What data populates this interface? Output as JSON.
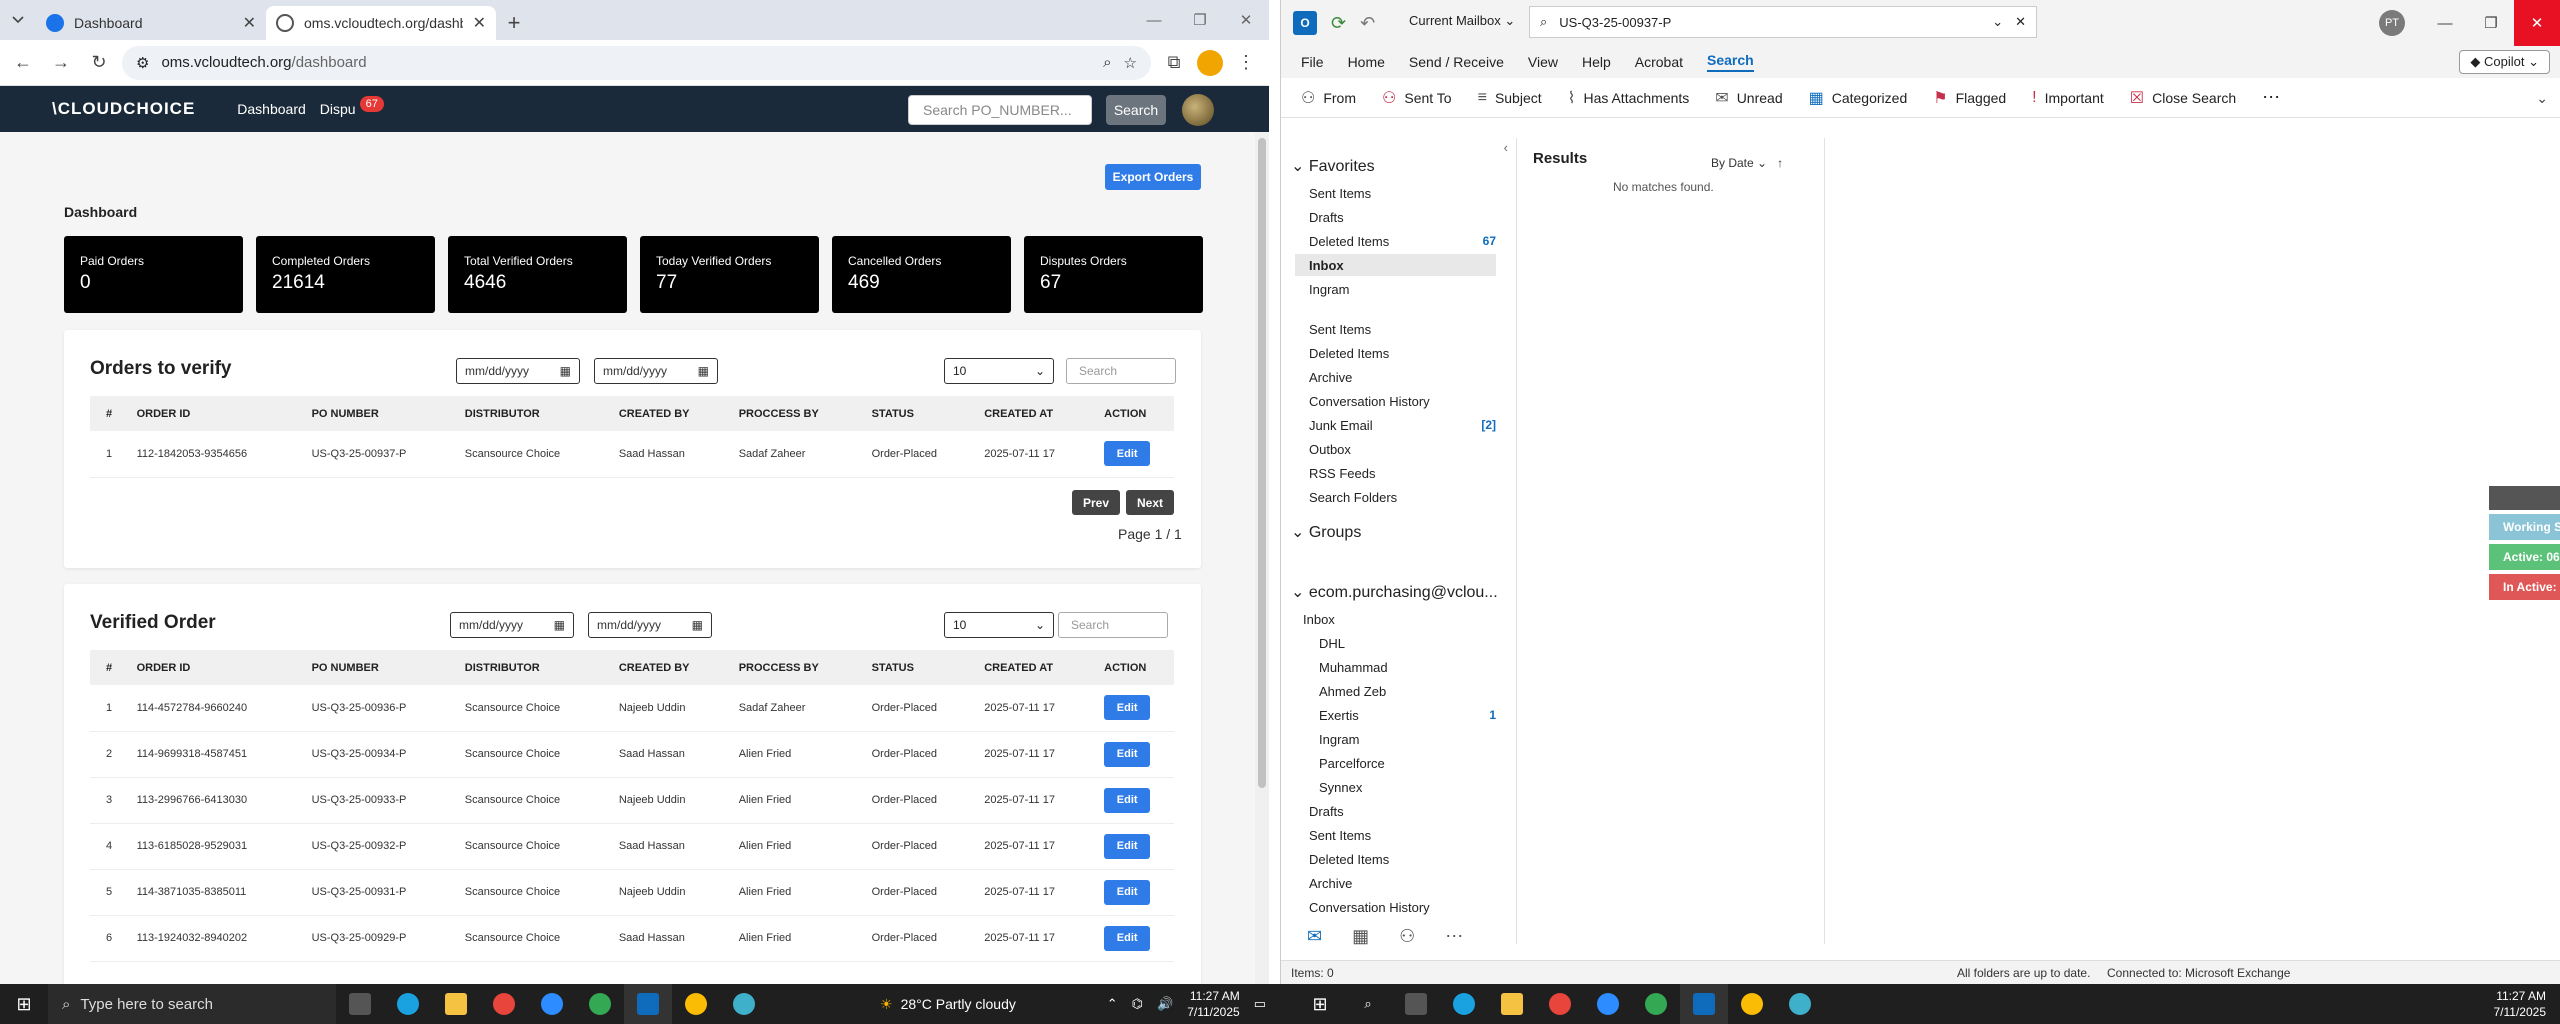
{
  "browser": {
    "tabs": [
      {
        "title": "Dashboard",
        "active": false
      },
      {
        "title": "oms.vcloudtech.org/dashboard",
        "active": true
      }
    ],
    "url_host": "oms.vcloudtech.org",
    "url_path": "/dashboard"
  },
  "app": {
    "logo": "\\CLOUDCHOICE",
    "nav": {
      "dashboard": "Dashboard",
      "disputes": "Dispu",
      "disputes_badge": "67"
    },
    "search_placeholder": "Search PO_NUMBER...",
    "search_button": "Search",
    "export_button": "Export Orders",
    "dashboard_title": "Dashboard",
    "stats": [
      {
        "label": "Paid Orders",
        "value": "0"
      },
      {
        "label": "Completed Orders",
        "value": "21614"
      },
      {
        "label": "Total Verified Orders",
        "value": "4646"
      },
      {
        "label": "Today Verified Orders",
        "value": "77"
      },
      {
        "label": "Cancelled Orders",
        "value": "469"
      },
      {
        "label": "Disputes Orders",
        "value": "67"
      }
    ],
    "date_placeholder": "mm/dd/yyyy",
    "page_size": "10",
    "table_search": "Search",
    "columns": [
      "#",
      "ORDER ID",
      "PO NUMBER",
      "DISTRIBUTOR",
      "CREATED BY",
      "PROCCESS BY",
      "STATUS",
      "CREATED AT",
      "ACTION"
    ],
    "edit_label": "Edit",
    "orders_to_verify": {
      "title": "Orders to verify",
      "rows": [
        [
          "1",
          "112-1842053-9354656",
          "US-Q3-25-00937-P",
          "Scansource Choice",
          "Saad Hassan",
          "Sadaf Zaheer",
          "Order-Placed",
          "2025-07-11 17"
        ]
      ],
      "prev": "Prev",
      "next": "Next",
      "page_info": "Page 1 / 1"
    },
    "verified_order": {
      "title": "Verified Order",
      "rows": [
        [
          "1",
          "114-4572784-9660240",
          "US-Q3-25-00936-P",
          "Scansource Choice",
          "Najeeb Uddin",
          "Sadaf Zaheer",
          "Order-Placed",
          "2025-07-11 17"
        ],
        [
          "2",
          "114-9699318-4587451",
          "US-Q3-25-00934-P",
          "Scansource Choice",
          "Saad Hassan",
          "Alien Fried",
          "Order-Placed",
          "2025-07-11 17"
        ],
        [
          "3",
          "113-2996766-6413030",
          "US-Q3-25-00933-P",
          "Scansource Choice",
          "Najeeb Uddin",
          "Alien Fried",
          "Order-Placed",
          "2025-07-11 17"
        ],
        [
          "4",
          "113-6185028-9529031",
          "US-Q3-25-00932-P",
          "Scansource Choice",
          "Saad Hassan",
          "Alien Fried",
          "Order-Placed",
          "2025-07-11 17"
        ],
        [
          "5",
          "114-3871035-8385011",
          "US-Q3-25-00931-P",
          "Scansource Choice",
          "Najeeb Uddin",
          "Alien Fried",
          "Order-Placed",
          "2025-07-11 17"
        ],
        [
          "6",
          "113-1924032-8940202",
          "US-Q3-25-00929-P",
          "Scansource Choice",
          "Saad Hassan",
          "Alien Fried",
          "Order-Placed",
          "2025-07-11 17"
        ]
      ]
    }
  },
  "outlook": {
    "scope": "Current Mailbox",
    "search_query": "US-Q3-25-00937-P",
    "avatar": "PT",
    "menu": [
      "File",
      "Home",
      "Send / Receive",
      "View",
      "Help",
      "Acrobat",
      "Search"
    ],
    "copilot": "Copilot",
    "ribbon": [
      "From",
      "Sent To",
      "Subject",
      "Has Attachments",
      "Unread",
      "Categorized",
      "Flagged",
      "Important",
      "Close Search"
    ],
    "favorites_head": "Favorites",
    "favorites": [
      {
        "name": "Sent Items",
        "count": ""
      },
      {
        "name": "Drafts",
        "count": ""
      },
      {
        "name": "Deleted Items",
        "count": "67"
      },
      {
        "name": "Inbox",
        "count": ""
      },
      {
        "name": "Ingram",
        "count": ""
      }
    ],
    "folders": [
      {
        "name": "Sent Items",
        "count": ""
      },
      {
        "name": "Deleted Items",
        "count": ""
      },
      {
        "name": "Archive",
        "count": ""
      },
      {
        "name": "Conversation History",
        "count": ""
      },
      {
        "name": "Junk Email",
        "count": "[2]"
      },
      {
        "name": "Outbox",
        "count": ""
      },
      {
        "name": "RSS Feeds",
        "count": ""
      },
      {
        "name": "Search Folders",
        "count": ""
      }
    ],
    "groups_head": "Groups",
    "account_head": "ecom.purchasing@vclou...",
    "account_inbox": "Inbox",
    "inbox_sub": [
      {
        "name": "DHL",
        "count": ""
      },
      {
        "name": "Muhammad",
        "count": ""
      },
      {
        "name": "Ahmed Zeb",
        "count": ""
      },
      {
        "name": "Exertis",
        "count": "1"
      },
      {
        "name": "Ingram",
        "count": ""
      },
      {
        "name": "Parcelforce",
        "count": ""
      },
      {
        "name": "Synnex",
        "count": ""
      }
    ],
    "account_folders": [
      "Drafts",
      "Sent Items",
      "Deleted Items",
      "Archive",
      "Conversation History"
    ],
    "results_title": "Results",
    "sort_label": "By Date",
    "no_matches": "No matches found.",
    "flyout": [
      "Working S",
      "Active: 06",
      "In Active:"
    ],
    "status_items": "Items: 0",
    "status_sync": "All folders are up to date.",
    "status_conn": "Connected to: Microsoft Exchange"
  },
  "taskbar": {
    "search_placeholder": "Type here to search",
    "weather": "28°C  Partly cloudy",
    "time": "11:27 AM",
    "date": "7/11/2025"
  }
}
